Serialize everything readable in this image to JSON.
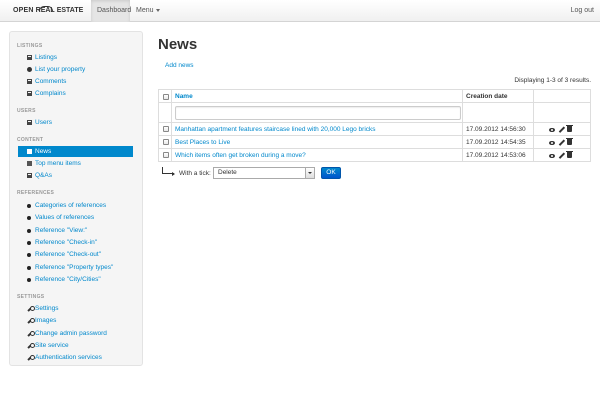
{
  "navbar": {
    "brand_part1": "OPEN",
    "brand_part2": "REAL",
    "brand_part3": "ESTATE",
    "dashboard": "Dashboard",
    "menu": "Menu",
    "logout": "Log out"
  },
  "sidebar": {
    "listings_header": "LISTINGS",
    "listings": [
      "Listings",
      "List your property",
      "Comments",
      "Complains"
    ],
    "users_header": "USERS",
    "users": [
      "Users"
    ],
    "content_header": "CONTENT",
    "content": [
      "News",
      "Top menu items",
      "Q&As"
    ],
    "references_header": "REFERENCES",
    "references": [
      "Categories of references",
      "Values of references",
      "Reference \"View:\"",
      "Reference \"Check-in\"",
      "Reference \"Check-out\"",
      "Reference \"Property types\"",
      "Reference \"City/Cities\""
    ],
    "settings_header": "SETTINGS",
    "settings": [
      "Settings",
      "Images",
      "Change admin password",
      "Site service",
      "Authentication services"
    ]
  },
  "main": {
    "title": "News",
    "add_link": "Add news",
    "summary": "Displaying 1-3 of 3 results.",
    "columns": {
      "name": "Name",
      "date": "Creation date"
    },
    "filter_value": "",
    "rows": [
      {
        "name": "Manhattan apartment features staircase lined with 20,000 Lego bricks",
        "date": "17.09.2012 14:56:30"
      },
      {
        "name": "Best Places to Live",
        "date": "17.09.2012 14:54:35"
      },
      {
        "name": "Which items often get broken during a move?",
        "date": "17.09.2012 14:53:06"
      }
    ],
    "bulk_label": "With a tick:",
    "bulk_selected": "Delete",
    "ok_label": "OK"
  },
  "colors": {
    "link": "#0088cc",
    "active": "#0088cc"
  }
}
